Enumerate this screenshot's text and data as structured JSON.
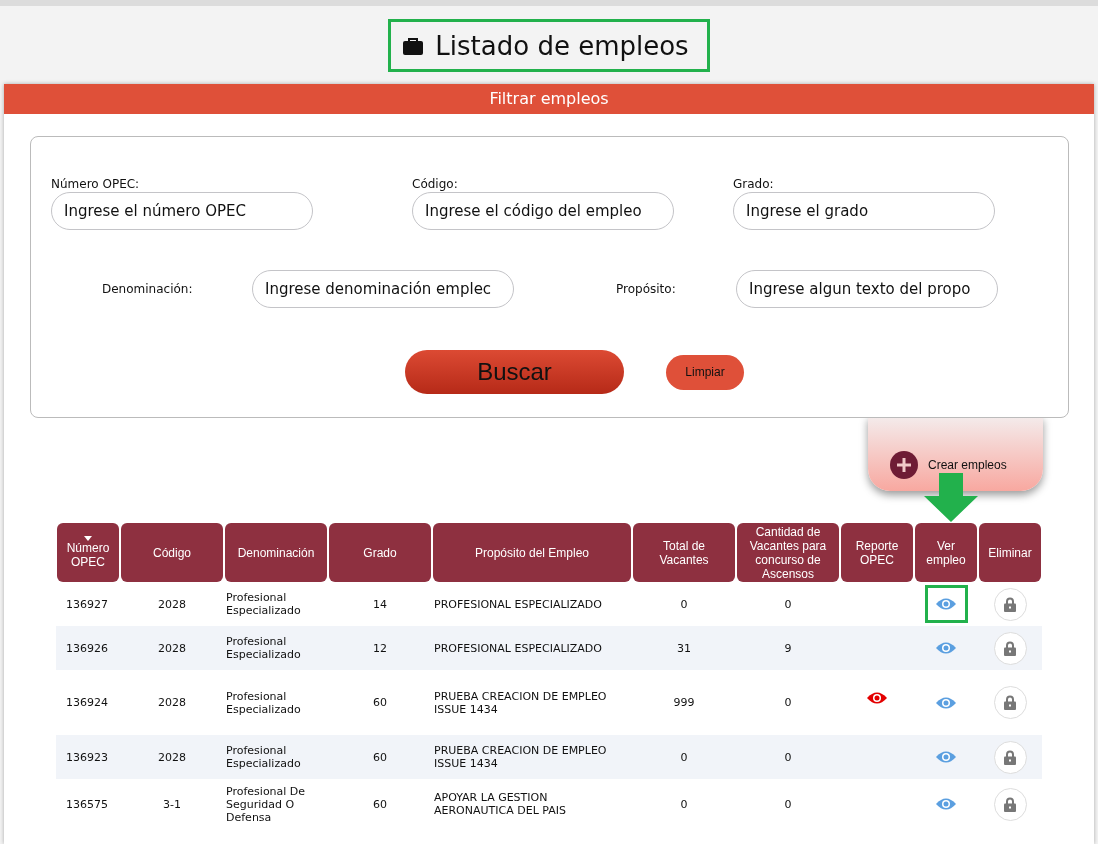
{
  "title": {
    "text": "Listado de empleos",
    "highlighted": true
  },
  "filter_panel": {
    "header": "Filtrar empleos",
    "fields": [
      {
        "label": "Número OPEC:",
        "placeholder": "Ingrese el número OPEC"
      },
      {
        "label": "Código:",
        "placeholder": "Ingrese el código del empleo"
      },
      {
        "label": "Grado:",
        "placeholder": "Ingrese el grado"
      },
      {
        "label": "Denominación:",
        "placeholder": "Ingrese denominación emplec"
      },
      {
        "label": "Propósito:",
        "placeholder": "Ingrese algun texto del propo"
      }
    ],
    "search_button": "Buscar",
    "clear_button": "Limpiar"
  },
  "create_button": "Crear empleos",
  "table": {
    "columns": [
      {
        "label": "Número OPEC",
        "sorted": true
      },
      {
        "label": "Código",
        "sorted": false
      },
      {
        "label": "Denominación",
        "sorted": false
      },
      {
        "label": "Grado",
        "sorted": false
      },
      {
        "label": "Propósito del Empleo",
        "sorted": false
      },
      {
        "label": "Total de Vacantes",
        "sorted": false
      },
      {
        "label": "Cantidad de Vacantes para concurso de Ascensos",
        "sorted": false
      },
      {
        "label": "Reporte OPEC",
        "sorted": false
      },
      {
        "label": "Ver empleo",
        "sorted": false
      },
      {
        "label": "Eliminar",
        "sorted": false
      }
    ],
    "rows": [
      {
        "opec": "136927",
        "code": "2028",
        "name": "Profesional Especializado",
        "grade": "14",
        "purpose": "PROFESIONAL ESPECIALIZADO",
        "total": "0",
        "promotion": "0",
        "report": false,
        "highlighted": true
      },
      {
        "opec": "136926",
        "code": "2028",
        "name": "Profesional Especializado",
        "grade": "12",
        "purpose": "PROFESIONAL ESPECIALIZADO",
        "total": "31",
        "promotion": "9",
        "report": false,
        "highlighted": false
      },
      {
        "opec": "136924",
        "code": "2028",
        "name": "Profesional Especializado",
        "grade": "60",
        "purpose": "PRUEBA CREACION DE EMPLEO ISSUE 1434",
        "total": "999",
        "promotion": "0",
        "report": true,
        "highlighted": false
      },
      {
        "opec": "136923",
        "code": "2028",
        "name": "Profesional Especializado",
        "grade": "60",
        "purpose": "PRUEBA CREACION DE EMPLEO ISSUE 1434",
        "total": "0",
        "promotion": "0",
        "report": false,
        "highlighted": false
      },
      {
        "opec": "136575",
        "code": "3-1",
        "name": "Profesional De Seguridad O Defensa",
        "grade": "60",
        "purpose": "APOYAR LA GESTION AERONAUTICA DEL PAIS",
        "total": "0",
        "promotion": "0",
        "report": false,
        "highlighted": false
      }
    ]
  }
}
